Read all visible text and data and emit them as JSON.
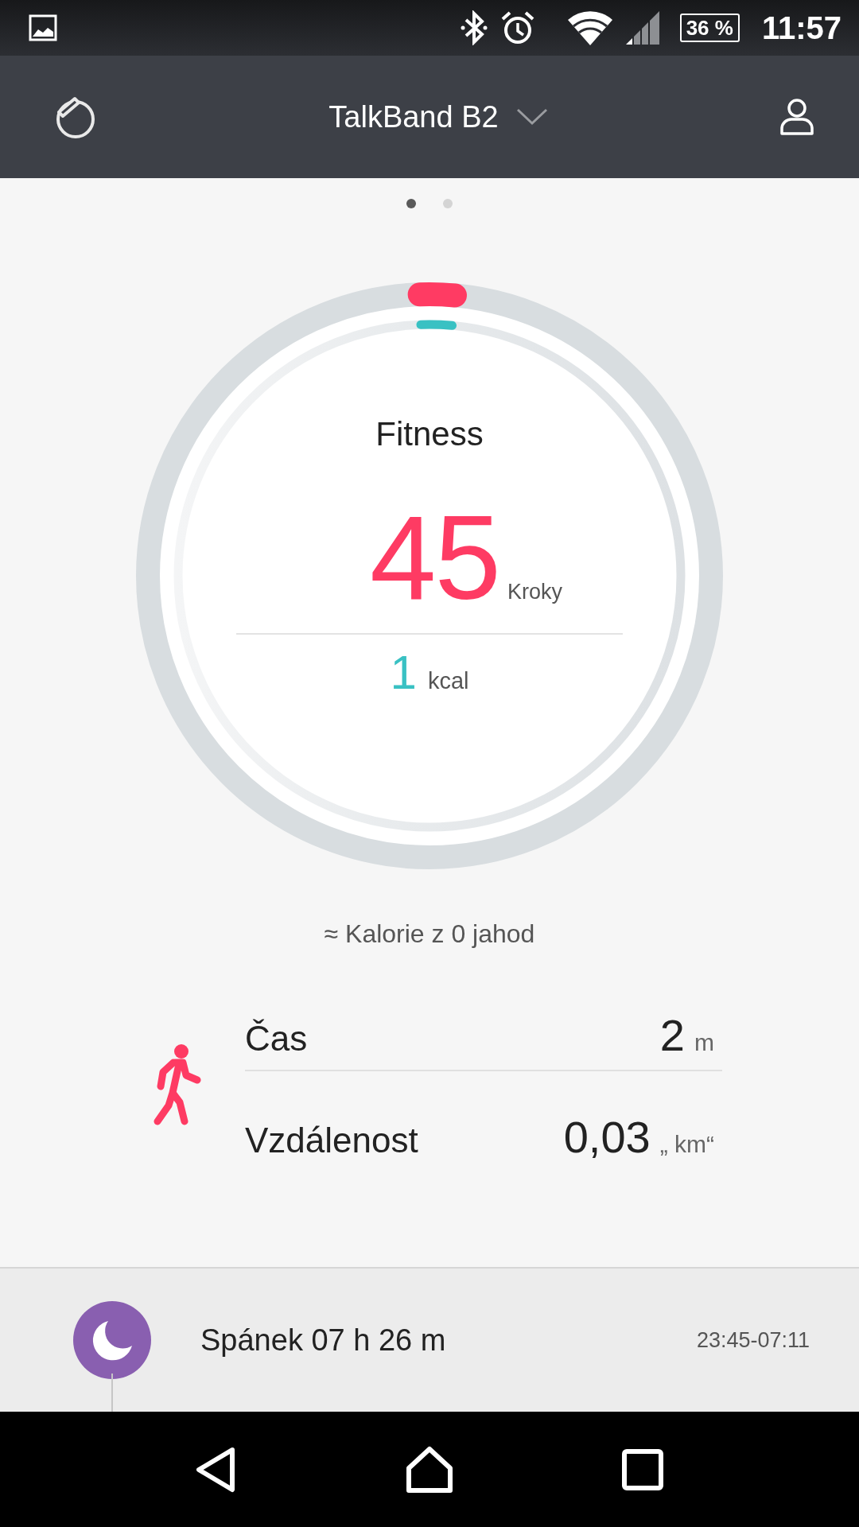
{
  "status_bar": {
    "battery": "36 %",
    "time": "11:57"
  },
  "header": {
    "title": "TalkBand B2"
  },
  "pager": [
    {
      "selected": true
    },
    {
      "selected": false
    }
  ],
  "fitness": {
    "title": "Fitness",
    "steps": "45",
    "steps_unit": "Kroky",
    "calories": "1",
    "calories_unit": "kcal",
    "step_ring": {
      "level": 0.02
    },
    "calorie_ring": {
      "level": 0.02
    }
  },
  "calorie_note": "≈ Kalorie z 0 jahod",
  "stats": [
    {
      "label": "Čas",
      "value": "2",
      "unit": "m"
    },
    {
      "label": "Vzdálenost",
      "value": "0,03",
      "unit": "„ km“"
    }
  ],
  "sleep": {
    "label": "Spánek 07 h 26 m",
    "range": "23:45-07:11"
  }
}
